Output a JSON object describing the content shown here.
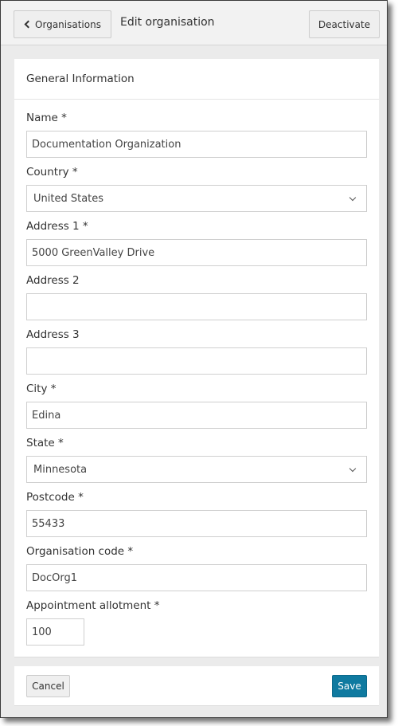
{
  "header": {
    "back_label": "Organisations",
    "title": "Edit organisation",
    "deactivate_label": "Deactivate"
  },
  "section": {
    "title": "General Information"
  },
  "fields": {
    "name": {
      "label": "Name *",
      "value": "Documentation Organization"
    },
    "country": {
      "label": "Country *",
      "value": "United States"
    },
    "address1": {
      "label": "Address 1 *",
      "value": "5000 GreenValley Drive"
    },
    "address2": {
      "label": "Address 2",
      "value": ""
    },
    "address3": {
      "label": "Address 3",
      "value": ""
    },
    "city": {
      "label": "City *",
      "value": "Edina"
    },
    "state": {
      "label": "State *",
      "value": "Minnesota"
    },
    "postcode": {
      "label": "Postcode *",
      "value": "55433"
    },
    "org_code": {
      "label": "Organisation code *",
      "value": "DocOrg1"
    },
    "allotment": {
      "label": "Appointment allotment *",
      "value": "100"
    }
  },
  "footer": {
    "cancel_label": "Cancel",
    "save_label": "Save"
  },
  "colors": {
    "primary": "#0f7aa0",
    "background": "#ebebeb",
    "header": "#f2f2f2"
  }
}
